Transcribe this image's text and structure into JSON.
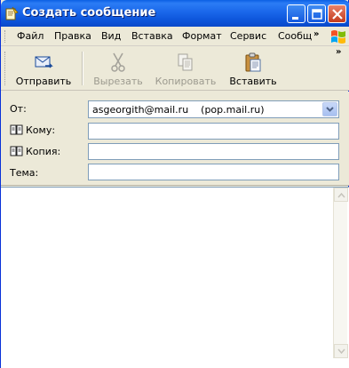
{
  "window": {
    "title": "Создать сообщение"
  },
  "menu": {
    "items": [
      "Файл",
      "Правка",
      "Вид",
      "Вставка",
      "Формат",
      "Сервис",
      "Сообщ"
    ],
    "overflow": "»"
  },
  "toolbar": {
    "overflow": "»",
    "send": {
      "label": "Отправить",
      "icon": "send-mail-icon",
      "enabled": true
    },
    "cut": {
      "label": "Вырезать",
      "icon": "scissors-icon",
      "enabled": false
    },
    "copy": {
      "label": "Копировать",
      "icon": "copy-icon",
      "enabled": false
    },
    "paste": {
      "label": "Вставить",
      "icon": "clipboard-icon",
      "enabled": true
    }
  },
  "headers": {
    "from_label": "От:",
    "from_value": "asgeorgith@mail.ru    (pop.mail.ru)",
    "to_label": "Кому:",
    "to_value": "",
    "cc_label": "Копия:",
    "cc_value": "",
    "subject_label": "Тема:",
    "subject_value": ""
  },
  "message": {
    "body": ""
  },
  "colors": {
    "titlebar": "#0b52d8",
    "chrome": "#ece9d8",
    "field_border": "#7f9db9",
    "close_button": "#c43b1d"
  }
}
